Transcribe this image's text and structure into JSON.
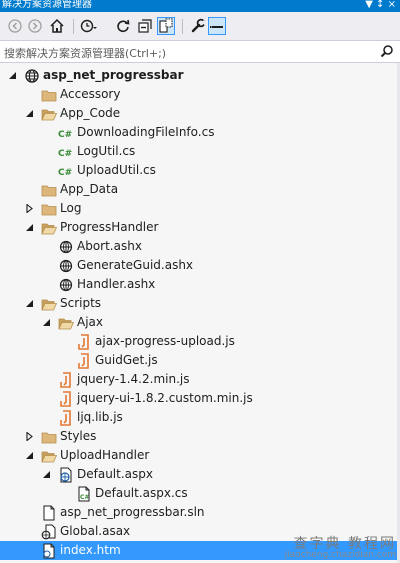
{
  "window": {
    "title": "解决方案资源管理器",
    "controls": "▼ ↕ ×"
  },
  "search": {
    "placeholder": "搜索解决方案资源管理器(Ctrl+;)"
  },
  "tree": [
    {
      "label": "asp_net_progressbar",
      "icon": "web-project-icon",
      "expander": "expanded",
      "level": 0,
      "bold": true
    },
    {
      "label": "Accessory",
      "icon": "folder-icon",
      "expander": "none",
      "level": 1
    },
    {
      "label": "App_Code",
      "icon": "folder-open-icon",
      "expander": "expanded",
      "level": 1
    },
    {
      "label": "DownloadingFileInfo.cs",
      "icon": "csharp-file-icon",
      "expander": "none",
      "level": 2
    },
    {
      "label": "LogUtil.cs",
      "icon": "csharp-file-icon",
      "expander": "none",
      "level": 2
    },
    {
      "label": "UploadUtil.cs",
      "icon": "csharp-file-icon",
      "expander": "none",
      "level": 2
    },
    {
      "label": "App_Data",
      "icon": "folder-icon",
      "expander": "none",
      "level": 1
    },
    {
      "label": "Log",
      "icon": "folder-icon",
      "expander": "collapsed",
      "level": 1
    },
    {
      "label": "ProgressHandler",
      "icon": "folder-open-icon",
      "expander": "expanded",
      "level": 1
    },
    {
      "label": "Abort.ashx",
      "icon": "handler-file-icon",
      "expander": "none",
      "level": 2
    },
    {
      "label": "GenerateGuid.ashx",
      "icon": "handler-file-icon",
      "expander": "none",
      "level": 2
    },
    {
      "label": "Handler.ashx",
      "icon": "handler-file-icon",
      "expander": "none",
      "level": 2
    },
    {
      "label": "Scripts",
      "icon": "folder-open-icon",
      "expander": "expanded",
      "level": 1
    },
    {
      "label": "Ajax",
      "icon": "folder-open-icon",
      "expander": "expanded",
      "level": 2
    },
    {
      "label": "ajax-progress-upload.js",
      "icon": "js-file-icon",
      "expander": "none",
      "level": 3
    },
    {
      "label": "GuidGet.js",
      "icon": "js-file-icon",
      "expander": "none",
      "level": 3
    },
    {
      "label": "jquery-1.4.2.min.js",
      "icon": "js-file-icon",
      "expander": "none",
      "level": 2
    },
    {
      "label": "jquery-ui-1.8.2.custom.min.js",
      "icon": "js-file-icon",
      "expander": "none",
      "level": 2
    },
    {
      "label": "ljq.lib.js",
      "icon": "js-file-icon",
      "expander": "none",
      "level": 2
    },
    {
      "label": "Styles",
      "icon": "folder-icon",
      "expander": "collapsed",
      "level": 1
    },
    {
      "label": "UploadHandler",
      "icon": "folder-open-icon",
      "expander": "expanded",
      "level": 1
    },
    {
      "label": "Default.aspx",
      "icon": "aspx-file-icon",
      "expander": "expanded",
      "level": 2
    },
    {
      "label": "Default.aspx.cs",
      "icon": "csharp-page-file-icon",
      "expander": "none",
      "level": 3
    },
    {
      "label": "asp_net_progressbar.sln",
      "icon": "solution-file-icon",
      "expander": "none",
      "level": 1
    },
    {
      "label": "Global.asax",
      "icon": "asax-file-icon",
      "expander": "none",
      "level": 1
    },
    {
      "label": "index.htm",
      "icon": "html-file-icon",
      "expander": "none",
      "level": 1,
      "selected": true
    }
  ],
  "watermark": {
    "line1": "查字典 教程网",
    "line2": "jiaocheng.chazidian.com"
  },
  "colors": {
    "accent": "#007acc",
    "selection": "#3399ff",
    "folder": "#dcb67a",
    "js": "#e37933",
    "csharp": "#388a34"
  }
}
